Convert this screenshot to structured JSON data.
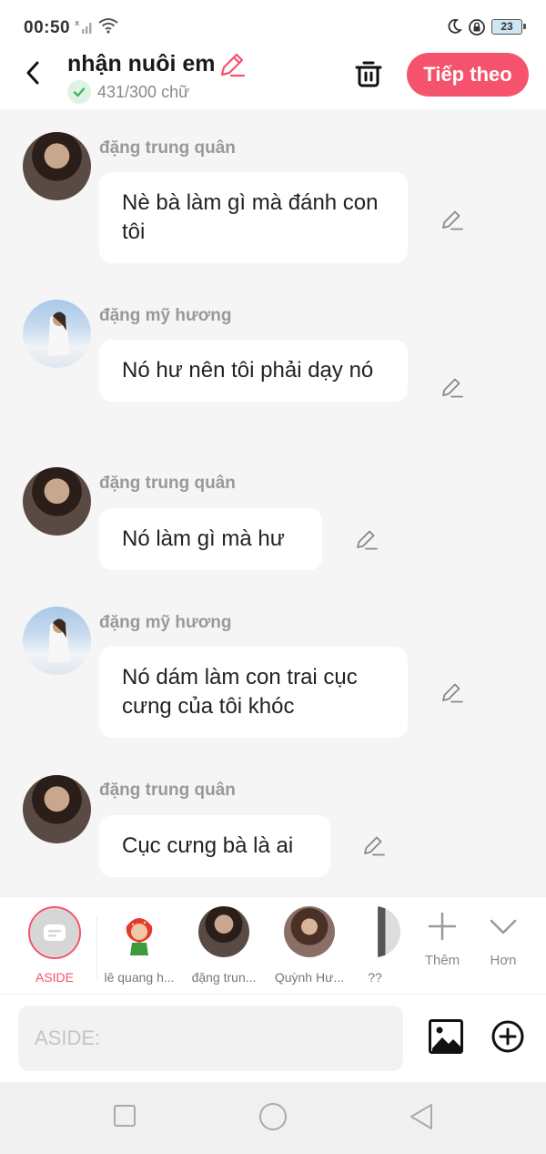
{
  "status": {
    "time": "00:50",
    "battery": "23"
  },
  "header": {
    "title": "nhận nuôi em",
    "word_count": "431/300 chữ",
    "next_label": "Tiếp theo"
  },
  "messages": [
    {
      "sender": "đặng trung quân",
      "text": "Nè bà làm gì mà đánh con tôi"
    },
    {
      "sender": "đặng mỹ hương",
      "text": "Nó hư nên tôi phải dạy nó"
    },
    {
      "sender": "đặng trung quân",
      "text": "Nó làm gì mà hư"
    },
    {
      "sender": "đặng mỹ hương",
      "text": "Nó dám làm con trai cục cưng của tôi khóc"
    },
    {
      "sender": "đặng trung quân",
      "text": "Cục cưng bà là ai"
    }
  ],
  "characters": {
    "aside_label": "ASIDE",
    "items": [
      "lê quang h...",
      "đặng trun...",
      "Quỳnh Hư...",
      "??"
    ],
    "more_label": "Thêm",
    "expand_label": "Hơn"
  },
  "input": {
    "placeholder": "ASIDE:"
  },
  "colors": {
    "accent": "#f5536d",
    "check": "#3fb55f",
    "edit_pink": "#f5536d"
  }
}
